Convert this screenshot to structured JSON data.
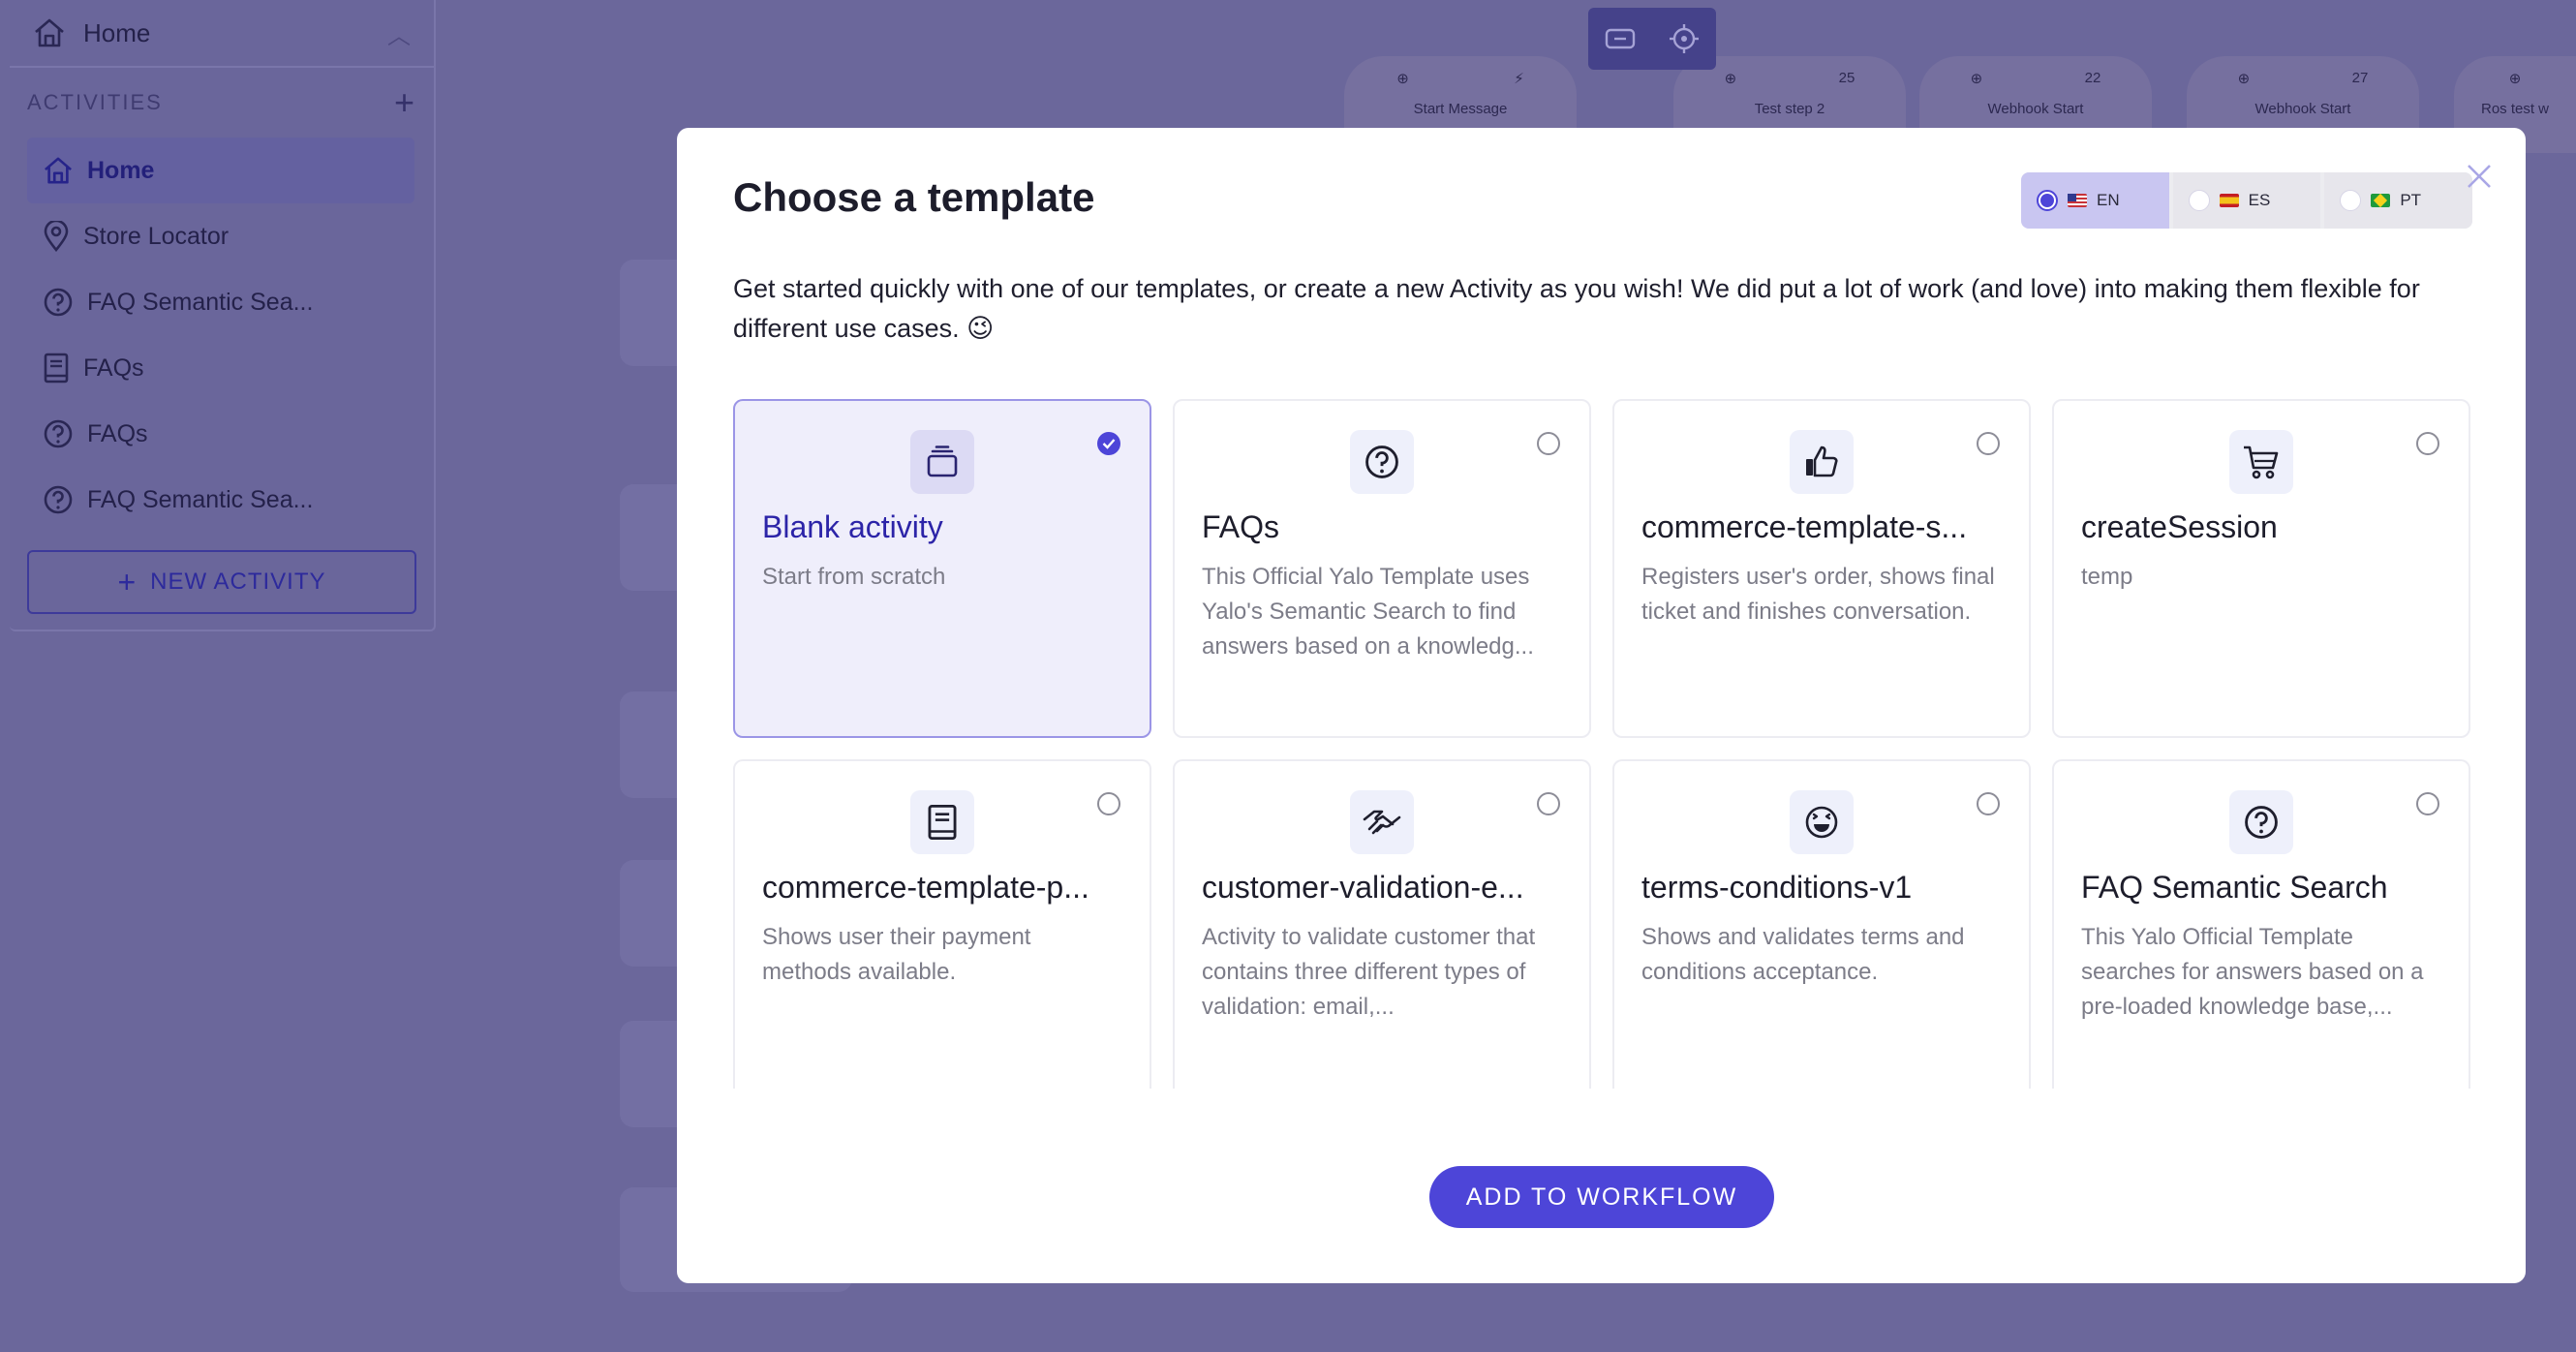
{
  "sidebar": {
    "home_label": "Home",
    "section_label": "ACTIVITIES",
    "items": [
      {
        "label": "Home",
        "icon": "home-icon"
      },
      {
        "label": "Store Locator",
        "icon": "map-pin-icon"
      },
      {
        "label": "FAQ Semantic Sea...",
        "icon": "question-circle-icon"
      },
      {
        "label": "FAQs",
        "icon": "book-icon"
      },
      {
        "label": "FAQs",
        "icon": "question-circle-icon"
      },
      {
        "label": "FAQ Semantic Sea...",
        "icon": "question-circle-icon"
      }
    ],
    "new_activity_label": "NEW ACTIVITY"
  },
  "canvas": {
    "nodes": [
      {
        "label": "Start Message",
        "badge": ""
      },
      {
        "label": "Test step 2",
        "badge": "25"
      },
      {
        "label": "Webhook Start",
        "badge": "22"
      },
      {
        "label": "Webhook Start",
        "badge": "27"
      },
      {
        "label": "Ros test w",
        "badge": ""
      }
    ]
  },
  "modal": {
    "title": "Choose a template",
    "description": "Get started quickly with one of our templates, or create a new Activity as you wish! We did put a lot of work (and love) into making them flexible for different use cases. 😉",
    "languages": [
      {
        "code": "EN",
        "selected": true
      },
      {
        "code": "ES",
        "selected": false
      },
      {
        "code": "PT",
        "selected": false
      }
    ],
    "templates": [
      {
        "title": "Blank activity",
        "desc": "Start from scratch",
        "icon": "layers-icon",
        "selected": true
      },
      {
        "title": "FAQs",
        "desc": "This Official Yalo Template uses Yalo's Semantic Search to find answers based on a knowledg...",
        "icon": "question-circle-icon",
        "selected": false
      },
      {
        "title": "commerce-template-s...",
        "desc": "Registers user's order, shows final ticket and finishes conversation.",
        "icon": "thumbs-up-icon",
        "selected": false
      },
      {
        "title": "createSession",
        "desc": "temp",
        "icon": "cart-icon",
        "selected": false
      },
      {
        "title": "commerce-template-p...",
        "desc": "Shows user their payment methods available.",
        "icon": "book-icon",
        "selected": false
      },
      {
        "title": "customer-validation-e...",
        "desc": "Activity to validate customer that contains three different types of validation: email,...",
        "icon": "handshake-icon",
        "selected": false
      },
      {
        "title": "terms-conditions-v1",
        "desc": "Shows and validates terms and conditions acceptance.",
        "icon": "wink-face-icon",
        "selected": false
      },
      {
        "title": "FAQ Semantic Search",
        "desc": "This Yalo Official Template searches for answers based on a pre-loaded knowledge base,...",
        "icon": "question-circle-icon",
        "selected": false
      }
    ],
    "add_button_label": "ADD TO WORKFLOW"
  },
  "colors": {
    "accent": "#4d45d8",
    "overlay": "#6b679b",
    "selected_card_bg": "#efeefb"
  }
}
